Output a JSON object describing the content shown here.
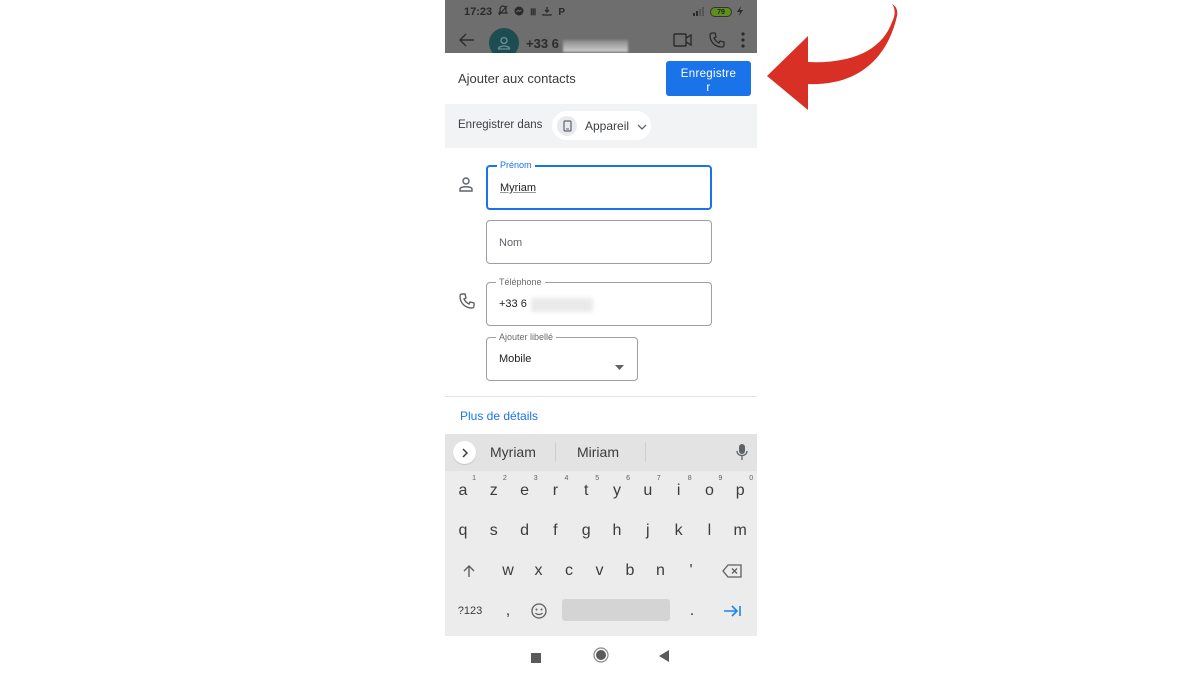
{
  "status_bar": {
    "time": "17:23",
    "icons": [
      "bell-off-icon",
      "messenger-icon",
      "ladder-icon",
      "download-icon",
      "p-icon"
    ],
    "battery_level": "79",
    "charging": true
  },
  "background_app": {
    "back_icon": "arrow-left-icon",
    "phone_prefix": "+33 6",
    "actions": [
      "video-call-icon",
      "phone-icon",
      "more-vert-icon"
    ]
  },
  "sheet": {
    "title": "Ajouter aux contacts",
    "save_label": "Enregistre\nr",
    "save_in_label": "Enregistrer dans",
    "account_chip": "Appareil"
  },
  "form": {
    "first_name": {
      "label": "Prénom",
      "value": "Myriam"
    },
    "last_name": {
      "placeholder": "Nom"
    },
    "phone": {
      "label": "Téléphone",
      "value": "+33 6"
    },
    "phone_label": {
      "label": "Ajouter libellé",
      "value": "Mobile"
    },
    "more_details": "Plus de détails"
  },
  "keyboard": {
    "suggestions": [
      "Myriam",
      "Miriam"
    ],
    "row1": [
      {
        "k": "a",
        "n": "1"
      },
      {
        "k": "z",
        "n": "2"
      },
      {
        "k": "e",
        "n": "3"
      },
      {
        "k": "r",
        "n": "4"
      },
      {
        "k": "t",
        "n": "5"
      },
      {
        "k": "y",
        "n": "6"
      },
      {
        "k": "u",
        "n": "7"
      },
      {
        "k": "i",
        "n": "8"
      },
      {
        "k": "o",
        "n": "9"
      },
      {
        "k": "p",
        "n": "0"
      }
    ],
    "row2": [
      "q",
      "s",
      "d",
      "f",
      "g",
      "h",
      "j",
      "k",
      "l",
      "m"
    ],
    "row3": [
      "w",
      "x",
      "c",
      "v",
      "b",
      "n",
      "'"
    ],
    "symbols_label": "?123",
    "comma": ",",
    "period": "."
  },
  "colors": {
    "accent": "#1a73e8",
    "annotation_arrow": "#d93025"
  }
}
